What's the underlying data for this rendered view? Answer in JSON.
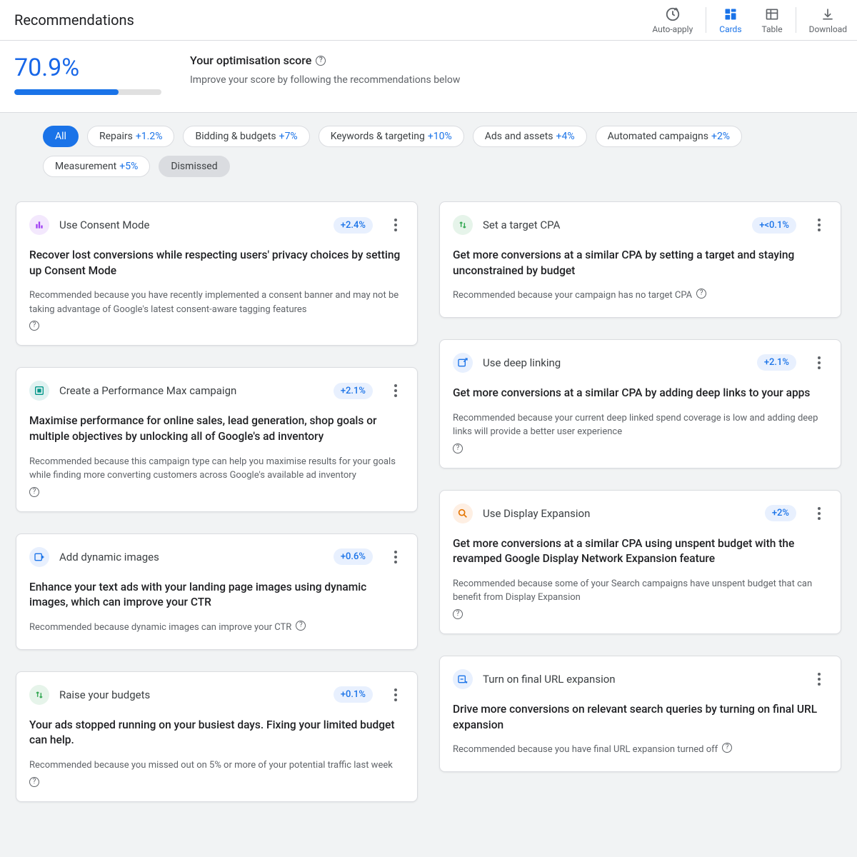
{
  "header": {
    "title": "Recommendations",
    "actions": {
      "auto_apply": "Auto-apply",
      "cards": "Cards",
      "table": "Table",
      "download": "Download"
    }
  },
  "score": {
    "percent": "70.9%",
    "progress_pct": 70.9,
    "title": "Your optimisation score",
    "subtitle": "Improve your score by following the recommendations below"
  },
  "chips": [
    {
      "label": "All",
      "delta": "",
      "variant": "active"
    },
    {
      "label": "Repairs",
      "delta": "+1.2%",
      "variant": ""
    },
    {
      "label": "Bidding & budgets",
      "delta": "+7%",
      "variant": ""
    },
    {
      "label": "Keywords & targeting",
      "delta": "+10%",
      "variant": ""
    },
    {
      "label": "Ads and assets",
      "delta": "+4%",
      "variant": ""
    },
    {
      "label": "Automated campaigns",
      "delta": "+2%",
      "variant": ""
    },
    {
      "label": "Measurement",
      "delta": "+5%",
      "variant": ""
    },
    {
      "label": "Dismissed",
      "delta": "",
      "variant": "muted"
    }
  ],
  "cards_left": [
    {
      "icon": "bars-icon",
      "icon_class": "ic-purple",
      "title": "Use Consent Mode",
      "delta": "+2.4%",
      "body": "Recover lost conversions while respecting users' privacy choices by setting up Consent Mode",
      "reason": "Recommended because you have recently implemented a consent banner and may not be taking advantage of Google's latest consent-aware tagging features"
    },
    {
      "icon": "campaign-icon",
      "icon_class": "ic-teal2",
      "title": "Create a Performance Max campaign",
      "delta": "+2.1%",
      "body": "Maximise performance for online sales, lead generation, shop goals or multiple objectives by unlocking all of Google's ad inventory",
      "reason": "Recommended because this campaign type can help you maximise results for your goals while finding more converting customers across Google's available ad inventory"
    },
    {
      "icon": "image-plus-icon",
      "icon_class": "ic-blue",
      "title": "Add dynamic images",
      "delta": "+0.6%",
      "body": "Enhance your text ads with your landing page images using dynamic images, which can improve your CTR",
      "reason": "Recommended because dynamic images can improve your CTR"
    },
    {
      "icon": "arrows-icon",
      "icon_class": "ic-green",
      "title": "Raise your budgets",
      "delta": "+0.1%",
      "body": "Your ads stopped running on your busiest days. Fixing your limited budget can help.",
      "reason": "Recommended because you missed out on 5% or more of your potential traffic last week"
    }
  ],
  "cards_right": [
    {
      "icon": "arrows-icon",
      "icon_class": "ic-green",
      "title": "Set a target CPA",
      "delta": "+<0.1%",
      "body": "Get more conversions at a similar CPA by setting a target and staying unconstrained by budget",
      "reason": "Recommended because your campaign has no target CPA"
    },
    {
      "icon": "link-icon",
      "icon_class": "ic-blue",
      "title": "Use deep linking",
      "delta": "+2.1%",
      "body": "Get more conversions at a similar CPA by adding deep links to your apps",
      "reason": "Recommended because your current deep linked spend coverage is low and adding deep links will provide a better user experience"
    },
    {
      "icon": "search-icon",
      "icon_class": "ic-orange",
      "title": "Use Display Expansion",
      "delta": "+2%",
      "body": "Get more conversions at a similar CPA using unspent budget with the revamped Google Display Network Expansion feature",
      "reason": "Recommended because some of your Search campaigns have unspent budget that can benefit from Display Expansion"
    },
    {
      "icon": "url-icon",
      "icon_class": "ic-blue",
      "title": "Turn on final URL expansion",
      "delta": "",
      "body": "Drive more conversions on relevant search queries by turning on final URL expansion",
      "reason": "Recommended because you have final URL expansion turned off"
    }
  ]
}
